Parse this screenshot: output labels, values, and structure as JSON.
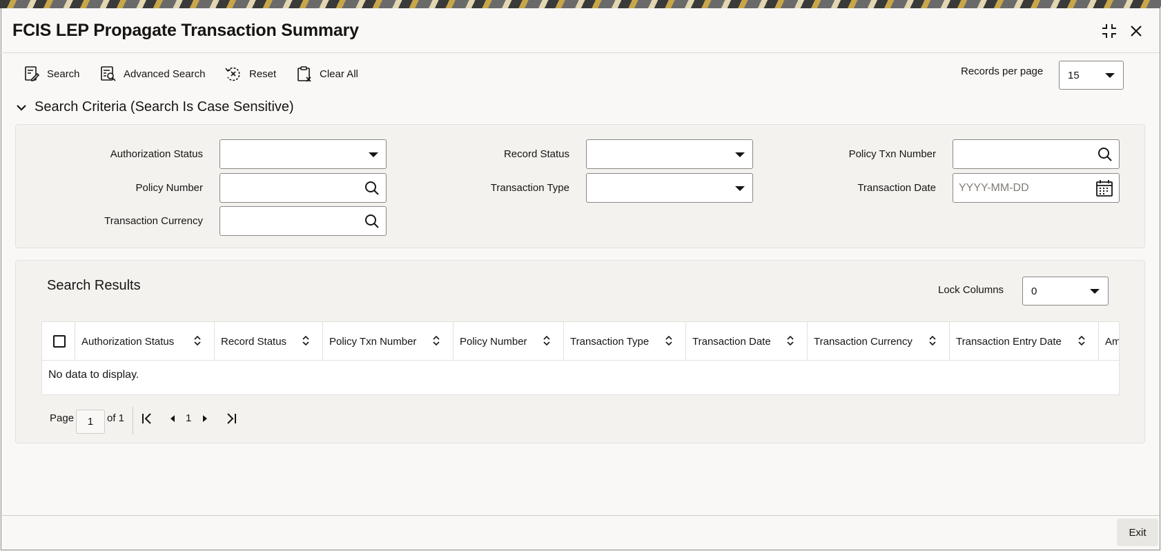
{
  "window": {
    "title": "FCIS LEP Propagate Transaction Summary",
    "expand_icon": "expand-icon",
    "close_icon": "close-icon"
  },
  "toolbar": {
    "search_label": "Search",
    "advanced_search_label": "Advanced Search",
    "reset_label": "Reset",
    "clear_all_label": "Clear All",
    "records_per_page_label": "Records per page",
    "records_per_page_value": "15"
  },
  "criteria": {
    "heading": "Search Criteria (Search Is Case Sensitive)",
    "authorization_status_label": "Authorization Status",
    "authorization_status_value": "",
    "record_status_label": "Record Status",
    "record_status_value": "",
    "policy_txn_number_label": "Policy Txn Number",
    "policy_txn_number_value": "",
    "policy_number_label": "Policy Number",
    "policy_number_value": "",
    "transaction_type_label": "Transaction Type",
    "transaction_type_value": "",
    "transaction_date_label": "Transaction Date",
    "transaction_date_placeholder": "YYYY-MM-DD",
    "transaction_currency_label": "Transaction Currency",
    "transaction_currency_value": ""
  },
  "results": {
    "heading": "Search Results",
    "lock_columns_label": "Lock Columns",
    "lock_columns_value": "0",
    "columns": [
      "Authorization Status",
      "Record Status",
      "Policy Txn Number",
      "Policy Number",
      "Transaction Type",
      "Transaction Date",
      "Transaction Currency",
      "Transaction Entry Date",
      "Am"
    ],
    "empty_message": "No data to display."
  },
  "pager": {
    "page_label": "Page",
    "current_page": "1",
    "of_label": "of 1",
    "page_number": "1"
  },
  "footer": {
    "exit_label": "Exit"
  },
  "colors": {
    "accent": "#161513",
    "panel": "#f3f2ef",
    "border": "#8a8784"
  }
}
